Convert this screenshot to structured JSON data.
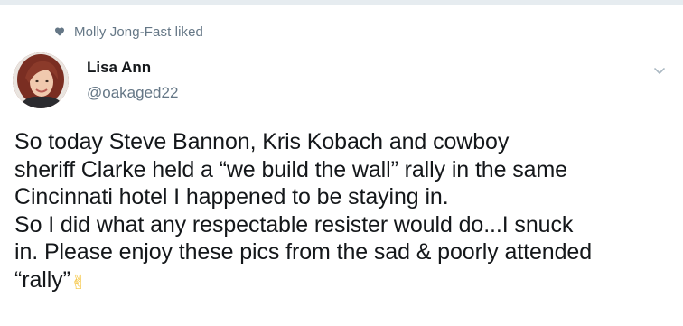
{
  "activity": {
    "liked_label": "Molly Jong-Fast liked",
    "icon": "heart-icon"
  },
  "author": {
    "name": "Lisa Ann",
    "handle": "@oakaged22",
    "avatar": "profile-photo"
  },
  "tweet": {
    "lines": [
      "So today Steve Bannon, Kris Kobach and cowboy",
      "sheriff Clarke held a “we build the wall” rally in the same",
      "Cincinnati hotel I happened to be staying in.",
      "So I did what any respectable resister would do...I snuck",
      "in. Please enjoy these pics from the sad & poorly attended",
      "“rally”"
    ],
    "emoji": "✌"
  },
  "menu": {
    "icon": "chevron-down-icon"
  },
  "colors": {
    "text_primary": "#14171a",
    "text_secondary": "#657786",
    "divider": "#e6ecf0",
    "emoji": "#f5c33b"
  }
}
